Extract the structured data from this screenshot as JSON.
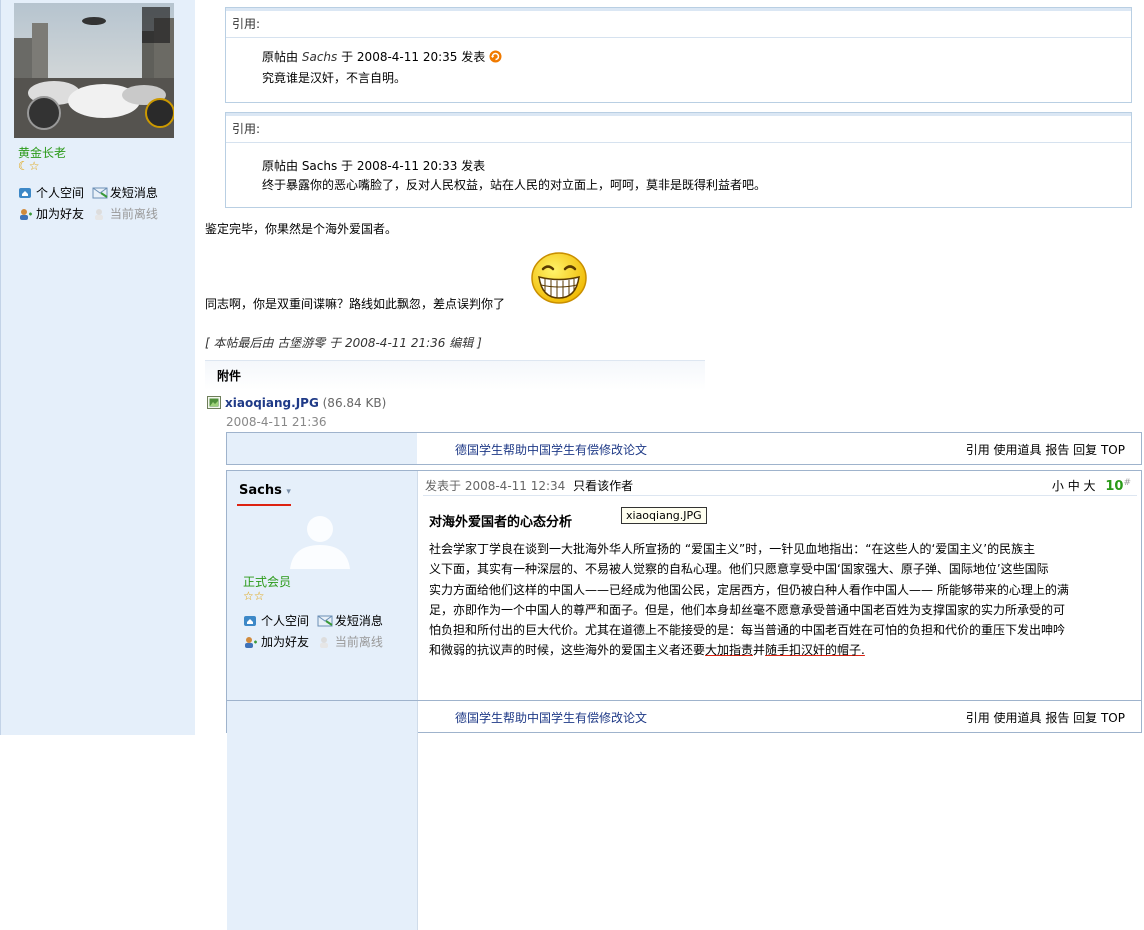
{
  "post1": {
    "user": {
      "rank": "黄金长老",
      "links": {
        "space": "个人空间",
        "message": "发短消息",
        "add_friend": "加为好友",
        "status": "当前离线"
      }
    },
    "quote1": {
      "label": "引用:",
      "intro": "原帖由",
      "author": "Sachs",
      "date_text": "于 2008-4-11 20:35 发表",
      "text": "究竟谁是汉奸，不言自明。"
    },
    "quote2": {
      "label": "引用:",
      "meta": "原帖由 Sachs 于 2008-4-11 20:33 发表",
      "text": "终于暴露你的恶心嘴脸了，反对人民权益，站在人民的对立面上，呵呵，莫非是既得利益者吧。"
    },
    "text1": "鉴定完毕，你果然是个海外爱国者。",
    "text2": "同志啊，你是双重间谍嘛？路线如此飘忽，差点误判你了",
    "edit_note": "[ 本帖最后由 古堡游零 于 2008-4-11 21:36 编辑 ]",
    "attachment": {
      "header": "附件",
      "filename": "xiaoqiang.JPG",
      "size": "(86.84 KB)",
      "date": "2008-4-11 21:36"
    },
    "footer": {
      "ad": "德国学生帮助中国学生有偿修改论文",
      "actions": "引用 使用道具 报告 回复 TOP"
    }
  },
  "post2": {
    "user": {
      "name": "Sachs",
      "rank": "正式会员",
      "links": {
        "space": "个人空间",
        "message": "发短消息",
        "add_friend": "加为好友",
        "status": "当前离线"
      }
    },
    "meta": "发表于 2008-4-11 12:34",
    "only_author": "只看该作者",
    "font_sizes": "小 中 大",
    "floor": "10",
    "floor_suffix": "#",
    "title": "对海外爱国者的心态分析",
    "tooltip": "xiaoqiang.JPG",
    "body_lines": [
      "社会学家丁学良在谈到一大批海外华人所宣扬的 “爱国主义”时，一针见血地指出：“在这些人的‘爱国主义’的民族主",
      "义下面，其实有一种深层的、不易被人觉察的自私心理。他们只愿意享受中国‘国家强大、原子弹、国际地位’这些国际",
      "实力方面给他们这样的中国人——已经成为他国公民，定居西方，但仍被白种人看作中国人—— 所能够带来的心理上的满",
      "足，亦即作为一个中国人的尊严和面子。但是，他们本身却丝毫不愿意承受普通中国老百姓为支撑国家的实力所承受的可",
      "怕负担和所付出的巨大代价。尤其在道德上不能接受的是：每当普通的中国老百姓在可怕的负担和代价的重压下发出呻吟"
    ],
    "last_line_prefix": "和微弱的抗议声的时候，这些海外的爱国主义者还要",
    "last_line_u1": "大加指责",
    "last_line_mid": "并",
    "last_line_u2": "随手扣汉奸的帽子.",
    "footer": {
      "ad": "德国学生帮助中国学生有偿修改论文",
      "actions": "引用 使用道具 报告 回复 TOP"
    }
  },
  "colors": {
    "sidebar_bg": "#e5effa",
    "border": "#9fb3cc",
    "link": "#1f3a87",
    "rank_green": "#2a9a18",
    "floor_green": "#2a9a18"
  }
}
